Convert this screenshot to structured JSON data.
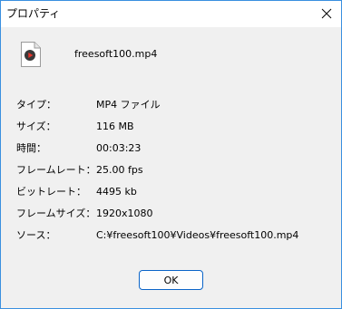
{
  "window": {
    "title": "プロパティ",
    "close_icon": "close-icon"
  },
  "file": {
    "icon": "video-file-icon",
    "name": "freesoft100.mp4"
  },
  "properties": [
    {
      "label": "タイプ：",
      "value": "MP4 ファイル"
    },
    {
      "label": "サイズ：",
      "value": "116 MB"
    },
    {
      "label": "時間：",
      "value": "00:03:23"
    },
    {
      "label": "フレームレート：",
      "value": "25.00 fps"
    },
    {
      "label": "ビットレート：",
      "value": "4495 kb"
    },
    {
      "label": "フレームサイズ：",
      "value": "1920x1080"
    },
    {
      "label": "ソース：",
      "value": "C:¥freesoft100¥Videos¥freesoft100.mp4"
    }
  ],
  "buttons": {
    "ok_label": "OK"
  },
  "colors": {
    "window_border": "#3a8fe0",
    "dialog_background": "#f0f0f0",
    "titlebar_background": "#ffffff",
    "button_border": "#0a64c8",
    "play_icon_red": "#e8352c"
  }
}
